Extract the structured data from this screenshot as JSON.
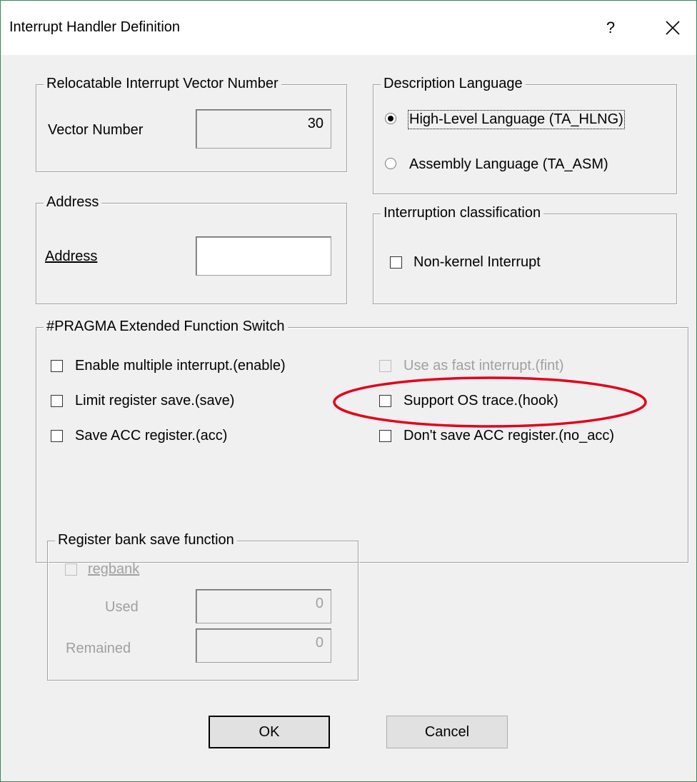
{
  "window": {
    "title": "Interrupt Handler Definition",
    "help": "?",
    "close_icon": "close-icon"
  },
  "vector_group": {
    "label": "Relocatable Interrupt Vector Number",
    "field_label": "Vector Number",
    "value": "30"
  },
  "address_group": {
    "label": "Address",
    "field_label": "Address",
    "value": ""
  },
  "language_group": {
    "label": "Description Language",
    "options": [
      {
        "label": "High-Level Language (TA_HLNG)",
        "selected": true
      },
      {
        "label": "Assembly Language (TA_ASM)",
        "selected": false
      }
    ]
  },
  "classification_group": {
    "label": "Interruption classification",
    "checkbox": "Non-kernel Interrupt",
    "checked": false
  },
  "pragma_group": {
    "label": "#PRAGMA Extended Function Switch",
    "left": [
      {
        "label": "Enable multiple interrupt.(enable)",
        "checked": false
      },
      {
        "label": "Limit register save.(save)",
        "checked": false
      },
      {
        "label": "Save ACC register.(acc)",
        "checked": false
      }
    ],
    "right": [
      {
        "label": "Use as fast interrupt.(fint)",
        "checked": false,
        "disabled": true
      },
      {
        "label": "Support OS trace.(hook)",
        "checked": false,
        "disabled": false
      },
      {
        "label": "Don't save ACC register.(no_acc)",
        "checked": false,
        "disabled": false
      }
    ]
  },
  "regbank_group": {
    "label": "Register bank save function",
    "checkbox": "regbank",
    "used_label": "Used",
    "used_value": "0",
    "remained_label": "Remained",
    "remained_value": "0"
  },
  "buttons": {
    "ok": "OK",
    "cancel": "Cancel"
  },
  "annotation_color": "#e3001b"
}
